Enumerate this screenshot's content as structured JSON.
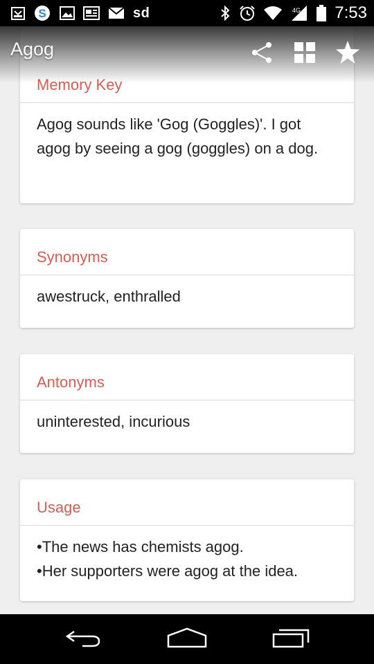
{
  "status_bar": {
    "carrier_text": "sd",
    "time": "7:53"
  },
  "action_bar": {
    "title": "Agog",
    "icons": [
      "share-icon",
      "grid-icon",
      "star-icon"
    ]
  },
  "cards": {
    "memory_key": {
      "title": "Memory Key",
      "body": "Agog sounds like 'Gog (Goggles)'. I got agog by seeing a gog (goggles) on a dog."
    },
    "synonyms": {
      "title": "Synonyms",
      "body": "awestruck, enthralled"
    },
    "antonyms": {
      "title": "Antonyms",
      "body": "uninterested, incurious"
    },
    "usage": {
      "title": "Usage",
      "lines": [
        "•The news has chemists agog.",
        "•Her supporters were agog at the idea."
      ]
    }
  },
  "colors": {
    "accent": "#e05a4e",
    "background": "#efefef"
  }
}
